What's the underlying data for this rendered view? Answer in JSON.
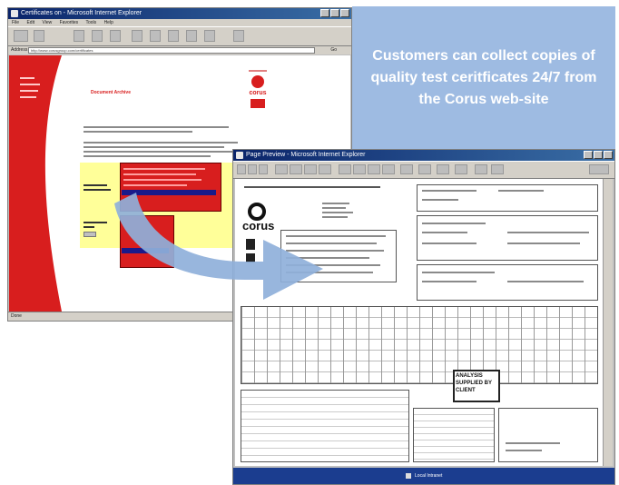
{
  "callout": {
    "text": "Customers can collect copies of quality test ceritficates 24/7 from the Corus web-site"
  },
  "browser": {
    "title": "Certificates on - Microsoft Internet Explorer",
    "menu": [
      "File",
      "Edit",
      "View",
      "Favorites",
      "Tools",
      "Help"
    ],
    "address_label": "Address",
    "address_value": "http://www.corusgroup.com/certificates",
    "go_label": "Go",
    "status": "Done",
    "page": {
      "heading": "Document Archive",
      "brand": "corus"
    }
  },
  "preview": {
    "title": "Page Preview - Microsoft Internet Explorer",
    "logo": "corus",
    "analysis_note": "ANALYSIS SUPPLIED BY CLIENT",
    "status": "Local Intranet"
  },
  "colors": {
    "brand_red": "#d81e1e",
    "callout_blue": "#9ebbe2",
    "arrow_blue": "#8fb0da",
    "highlight_yellow": "#ffff99"
  },
  "icons": {
    "arrow": "curved-arrow-icon",
    "browser_logo": "ie-icon"
  }
}
